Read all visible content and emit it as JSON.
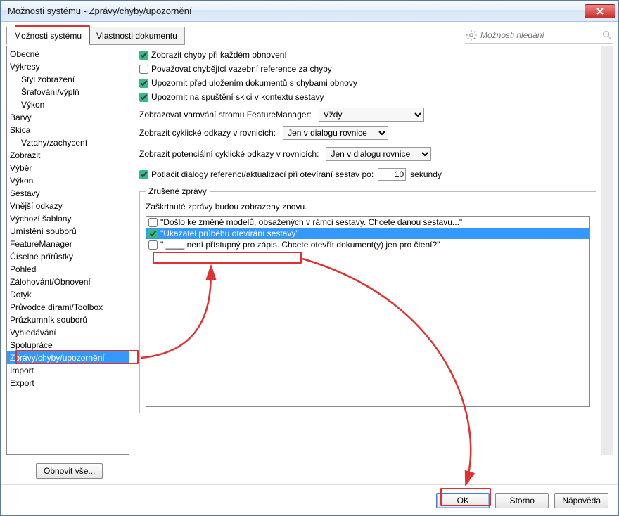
{
  "title": "Možnosti systému - Zprávy/chyby/upozornění",
  "tabs": {
    "system": "Možnosti systému",
    "document": "Vlastnosti dokumentu"
  },
  "search": {
    "placeholder": "Možnosti hledání"
  },
  "tree": {
    "items": [
      {
        "label": "Obecné",
        "indent": 0
      },
      {
        "label": "Výkresy",
        "indent": 0
      },
      {
        "label": "Styl zobrazení",
        "indent": 1
      },
      {
        "label": "Šrafování/výplň",
        "indent": 1
      },
      {
        "label": "Výkon",
        "indent": 1
      },
      {
        "label": "Barvy",
        "indent": 0
      },
      {
        "label": "Skica",
        "indent": 0
      },
      {
        "label": "Vztahy/zachycení",
        "indent": 1
      },
      {
        "label": "Zobrazit",
        "indent": 0
      },
      {
        "label": "Výběr",
        "indent": 0
      },
      {
        "label": "Výkon",
        "indent": 0
      },
      {
        "label": "Sestavy",
        "indent": 0
      },
      {
        "label": "Vnější odkazy",
        "indent": 0
      },
      {
        "label": "Výchozí šablony",
        "indent": 0
      },
      {
        "label": "Umístění souborů",
        "indent": 0
      },
      {
        "label": "FeatureManager",
        "indent": 0
      },
      {
        "label": "Číselné přírůstky",
        "indent": 0
      },
      {
        "label": "Pohled",
        "indent": 0
      },
      {
        "label": "Zálohování/Obnovení",
        "indent": 0
      },
      {
        "label": "Dotyk",
        "indent": 0
      },
      {
        "label": "Průvodce dírami/Toolbox",
        "indent": 0
      },
      {
        "label": "Průzkumník souborů",
        "indent": 0
      },
      {
        "label": "Vyhledávání",
        "indent": 0
      },
      {
        "label": "Spolupráce",
        "indent": 0
      },
      {
        "label": "Zprávy/chyby/upozornění",
        "indent": 0,
        "selected": true
      },
      {
        "label": "Import",
        "indent": 0
      },
      {
        "label": "Export",
        "indent": 0
      }
    ]
  },
  "options": {
    "show_errors": {
      "label": "Zobrazit chyby při každém obnovení",
      "checked": true
    },
    "missing_refs": {
      "label": "Považovat chybějící vazební reference za chyby",
      "checked": false
    },
    "warn_save": {
      "label": "Upozornit před uložením dokumentů s chybami obnovy",
      "checked": true
    },
    "warn_sketch": {
      "label": "Upozornit na spuštění skici v kontextu sestavy",
      "checked": true
    },
    "fm_warn_label": "Zobrazovat varování stromu FeatureManager:",
    "fm_warn_value": "Vždy",
    "cyclic_label": "Zobrazit cyklické odkazy v rovnicích:",
    "cyclic_value": "Jen v dialogu rovnice",
    "pot_cyclic_label": "Zobrazit potenciální cyklické odkazy v rovnicích:",
    "pot_cyclic_value": "Jen v dialogu rovnice",
    "suppress": {
      "label_a": "Potlačit dialogy referencí/aktualizací při otevírání sestav po:",
      "value": "10",
      "label_b": "sekundy",
      "checked": true
    }
  },
  "cancelled": {
    "legend": "Zrušené zprávy",
    "hint": "Zaškrtnuté zprávy budou zobrazeny znovu.",
    "msgs": [
      {
        "text": "\"Došlo ke změně modelů, obsažených v rámci sestavy.  Chcete danou sestavu...\"",
        "checked": false
      },
      {
        "text": "\"Ukazatel průběhu otevírání sestavy\"",
        "checked": true,
        "hl": true
      },
      {
        "text": "\" ____ není přístupný pro zápis.  Chcete otevřít dokument(y) jen pro čtení?\"",
        "checked": false
      }
    ]
  },
  "buttons": {
    "restore": "Obnovit vše...",
    "ok": "OK",
    "cancel": "Storno",
    "help": "Nápověda"
  }
}
